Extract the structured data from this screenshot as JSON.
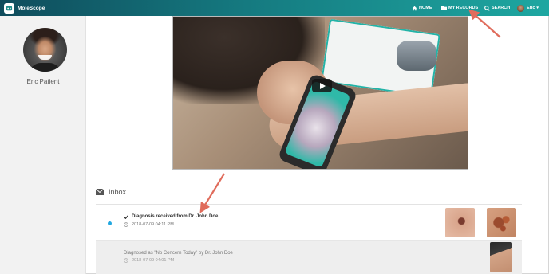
{
  "brand": {
    "name": "MoleScope",
    "logo_icon": "molescope-logo-icon"
  },
  "nav": {
    "home_label": "HOME",
    "records_label": "MY RECORDS",
    "search_label": "SEARCH",
    "user_label": "Eric"
  },
  "sidebar": {
    "patient_name": "Eric Patient"
  },
  "video": {
    "play_icon": "play-icon"
  },
  "inbox": {
    "title": "Inbox",
    "messages": [
      {
        "title": "Diagnosis received from Dr. John Doe",
        "time": "2018-07-09 04:11 PM",
        "unread": true
      },
      {
        "title": "Diagnosed as \"No Concern Today\" by Dr. John Doe",
        "time": "2018-07-09 04:01 PM",
        "unread": false
      }
    ]
  },
  "colors": {
    "nav_gradient_start": "#0f4c5c",
    "nav_gradient_end": "#1ea7a1",
    "annotation_arrow": "#e06c5c",
    "unread_dot": "#23a8e0"
  }
}
